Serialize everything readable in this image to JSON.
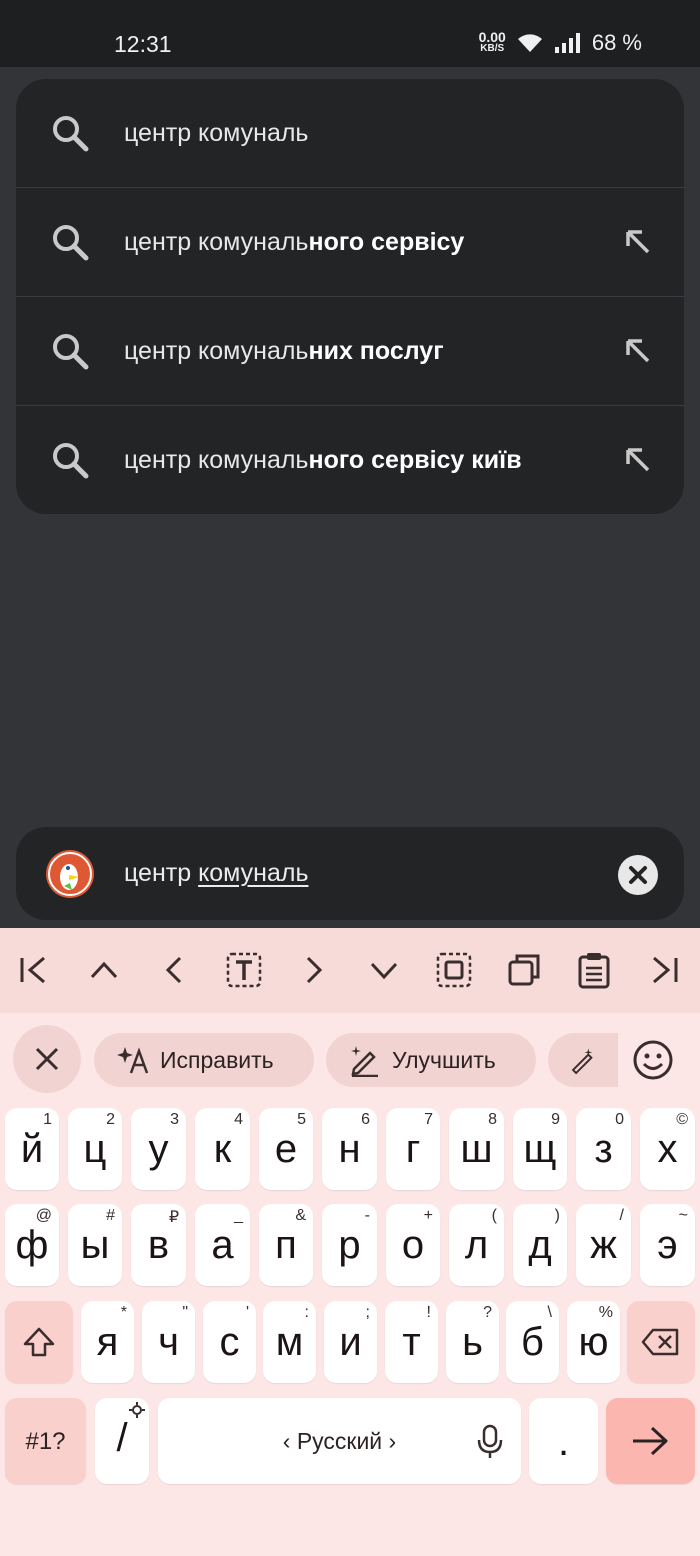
{
  "status": {
    "time": "12:31",
    "speed_value": "0.00",
    "speed_unit": "KB/S",
    "battery": "68 %"
  },
  "suggestions": [
    {
      "prefix": "центр комуналь",
      "bold": ""
    },
    {
      "prefix": "центр комуналь",
      "bold": "ного сервісу"
    },
    {
      "prefix": "центр комуналь",
      "bold": "них послуг"
    },
    {
      "prefix": "центр комуналь",
      "bold": "ного сервісу київ"
    }
  ],
  "search": {
    "prefix": "центр ",
    "underlined": "комуналь"
  },
  "keyboard": {
    "chips": {
      "fix": "Исправить",
      "improve": "Улучшить"
    },
    "row1": [
      [
        "й",
        "1"
      ],
      [
        "ц",
        "2"
      ],
      [
        "у",
        "3"
      ],
      [
        "к",
        "4"
      ],
      [
        "е",
        "5"
      ],
      [
        "н",
        "6"
      ],
      [
        "г",
        "7"
      ],
      [
        "ш",
        "8"
      ],
      [
        "щ",
        "9"
      ],
      [
        "з",
        "0"
      ],
      [
        "х",
        "©"
      ]
    ],
    "row2": [
      [
        "ф",
        "@"
      ],
      [
        "ы",
        "#"
      ],
      [
        "в",
        "₽"
      ],
      [
        "а",
        "_"
      ],
      [
        "п",
        "&"
      ],
      [
        "р",
        "-"
      ],
      [
        "о",
        "+"
      ],
      [
        "л",
        "("
      ],
      [
        "д",
        ")"
      ],
      [
        "ж",
        "/"
      ],
      [
        "э",
        "~"
      ]
    ],
    "row3": [
      [
        "я",
        "*"
      ],
      [
        "ч",
        "\""
      ],
      [
        "с",
        "'"
      ],
      [
        "м",
        ":"
      ],
      [
        "и",
        ";"
      ],
      [
        "т",
        "!"
      ],
      [
        "ь",
        "?"
      ],
      [
        "б",
        "\\"
      ],
      [
        "ю",
        "%"
      ]
    ],
    "symbols_label": "#1?",
    "slash_label": "/",
    "space_label": "‹ Русский ›",
    "period_label": "."
  },
  "colors": {
    "accent": "#fbb6b0",
    "keyboard_bg": "#fde7e6",
    "dark_bg": "#333438"
  }
}
